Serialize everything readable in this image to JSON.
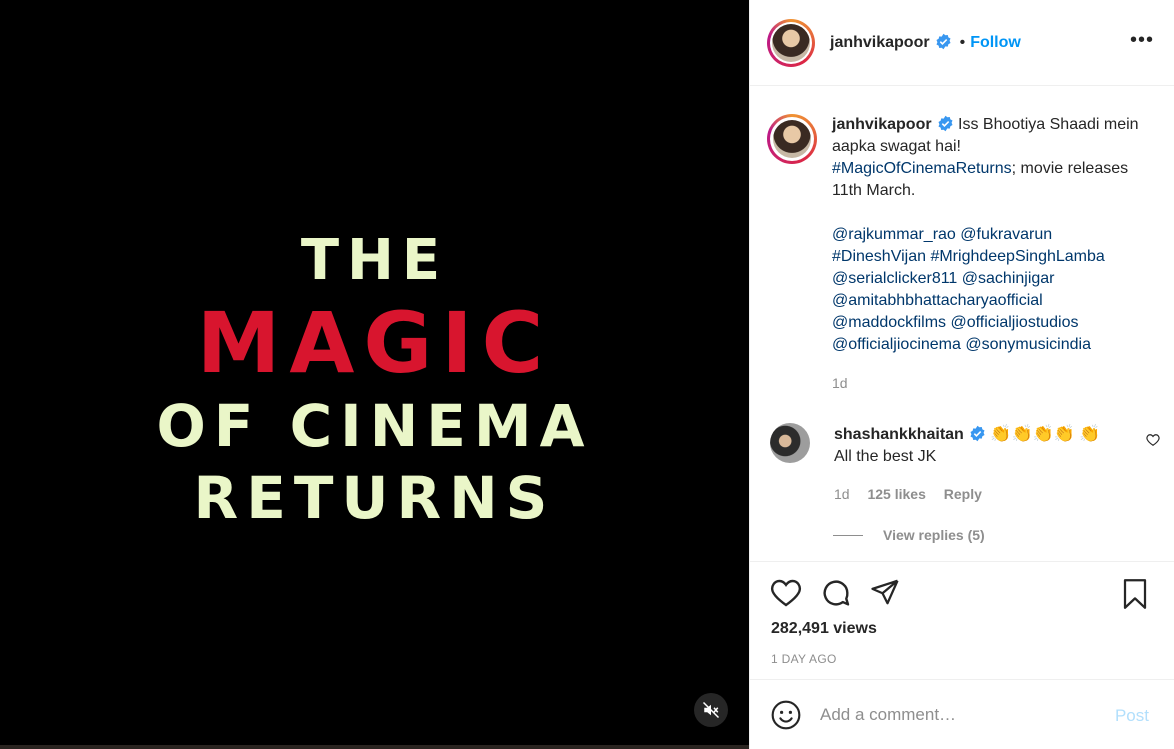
{
  "video": {
    "line1": "THE",
    "line2": "MAGIC",
    "line3": "OF CINEMA",
    "line4": "RETURNS",
    "mute_icon": "speaker-muted-icon"
  },
  "header": {
    "username": "janhvikapoor",
    "separator": "•",
    "follow_label": "Follow",
    "more_label": "•••"
  },
  "caption": {
    "username": "janhvikapoor",
    "text_1": "Iss Bhootiya Shaadi mein aapka swagat hai!",
    "hashtag_1": "#MagicOfCinemaReturns",
    "text_2": "; movie releases 11th March.",
    "mentions": [
      "@rajkummar_rao",
      "@fukravarun",
      "#DineshVijan",
      "#MrighdeepSinghLamba",
      "@serialclicker811",
      "@sachinjigar",
      "@amitabhbhattacharyaofficial",
      "@maddockfilms",
      "@officialjiostudios",
      "@officialjiocinema",
      "@sonymusicindia"
    ],
    "time": "1d"
  },
  "comment": {
    "username": "shashankkhaitan",
    "emojis": "👏👏👏👏",
    "emoji_2": "👏",
    "text": "All the best JK",
    "time": "1d",
    "likes": "125 likes",
    "reply_label": "Reply",
    "view_replies": "View replies (5)"
  },
  "actions": {
    "views": "282,491 views",
    "ago": "1 DAY AGO"
  },
  "add_comment": {
    "placeholder": "Add a comment…",
    "post_label": "Post"
  },
  "colors": {
    "accent": "#0095f6",
    "link": "#00376b",
    "muted": "#8e8e8e",
    "video_red": "#d8152e",
    "video_cream": "#eaf6c8"
  }
}
